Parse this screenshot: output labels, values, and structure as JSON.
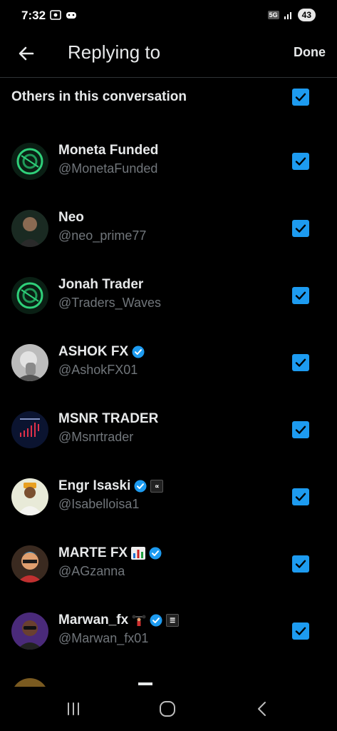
{
  "status": {
    "time": "7:32",
    "network": "5G",
    "battery": "43"
  },
  "header": {
    "title": "Replying to",
    "done_label": "Done"
  },
  "others": {
    "label": "Others in this conversation",
    "checked": true
  },
  "users": [
    {
      "name": "Moneta Funded",
      "handle": "@MonetaFunded",
      "verified": false,
      "avatar": "green-ring-logo"
    },
    {
      "name": "Neo",
      "handle": "@neo_prime77",
      "verified": false,
      "avatar": "portrait-man"
    },
    {
      "name": "Jonah Trader",
      "handle": "@Traders_Waves",
      "verified": false,
      "avatar": "green-ring-logo"
    },
    {
      "name": "ASHOK FX",
      "handle": "@AshokFX01",
      "verified": true,
      "avatar": "portrait-hand"
    },
    {
      "name": "MSNR TRADER",
      "handle": "@Msnrtrader",
      "verified": false,
      "avatar": "chart-logo"
    },
    {
      "name": "Engr Isaski",
      "handle": "@Isabelloisa1",
      "verified": true,
      "avatar": "portrait-cap"
    },
    {
      "name": "MARTE FX",
      "handle": "@AGzanna",
      "verified": true,
      "avatar": "portrait-cartoon"
    },
    {
      "name": "Marwan_fx",
      "handle": "@Marwan_fx01",
      "verified": true,
      "avatar": "portrait-glasses"
    }
  ],
  "colors": {
    "accent": "#1d9bf0",
    "background": "#000000",
    "muted": "#71767b"
  }
}
